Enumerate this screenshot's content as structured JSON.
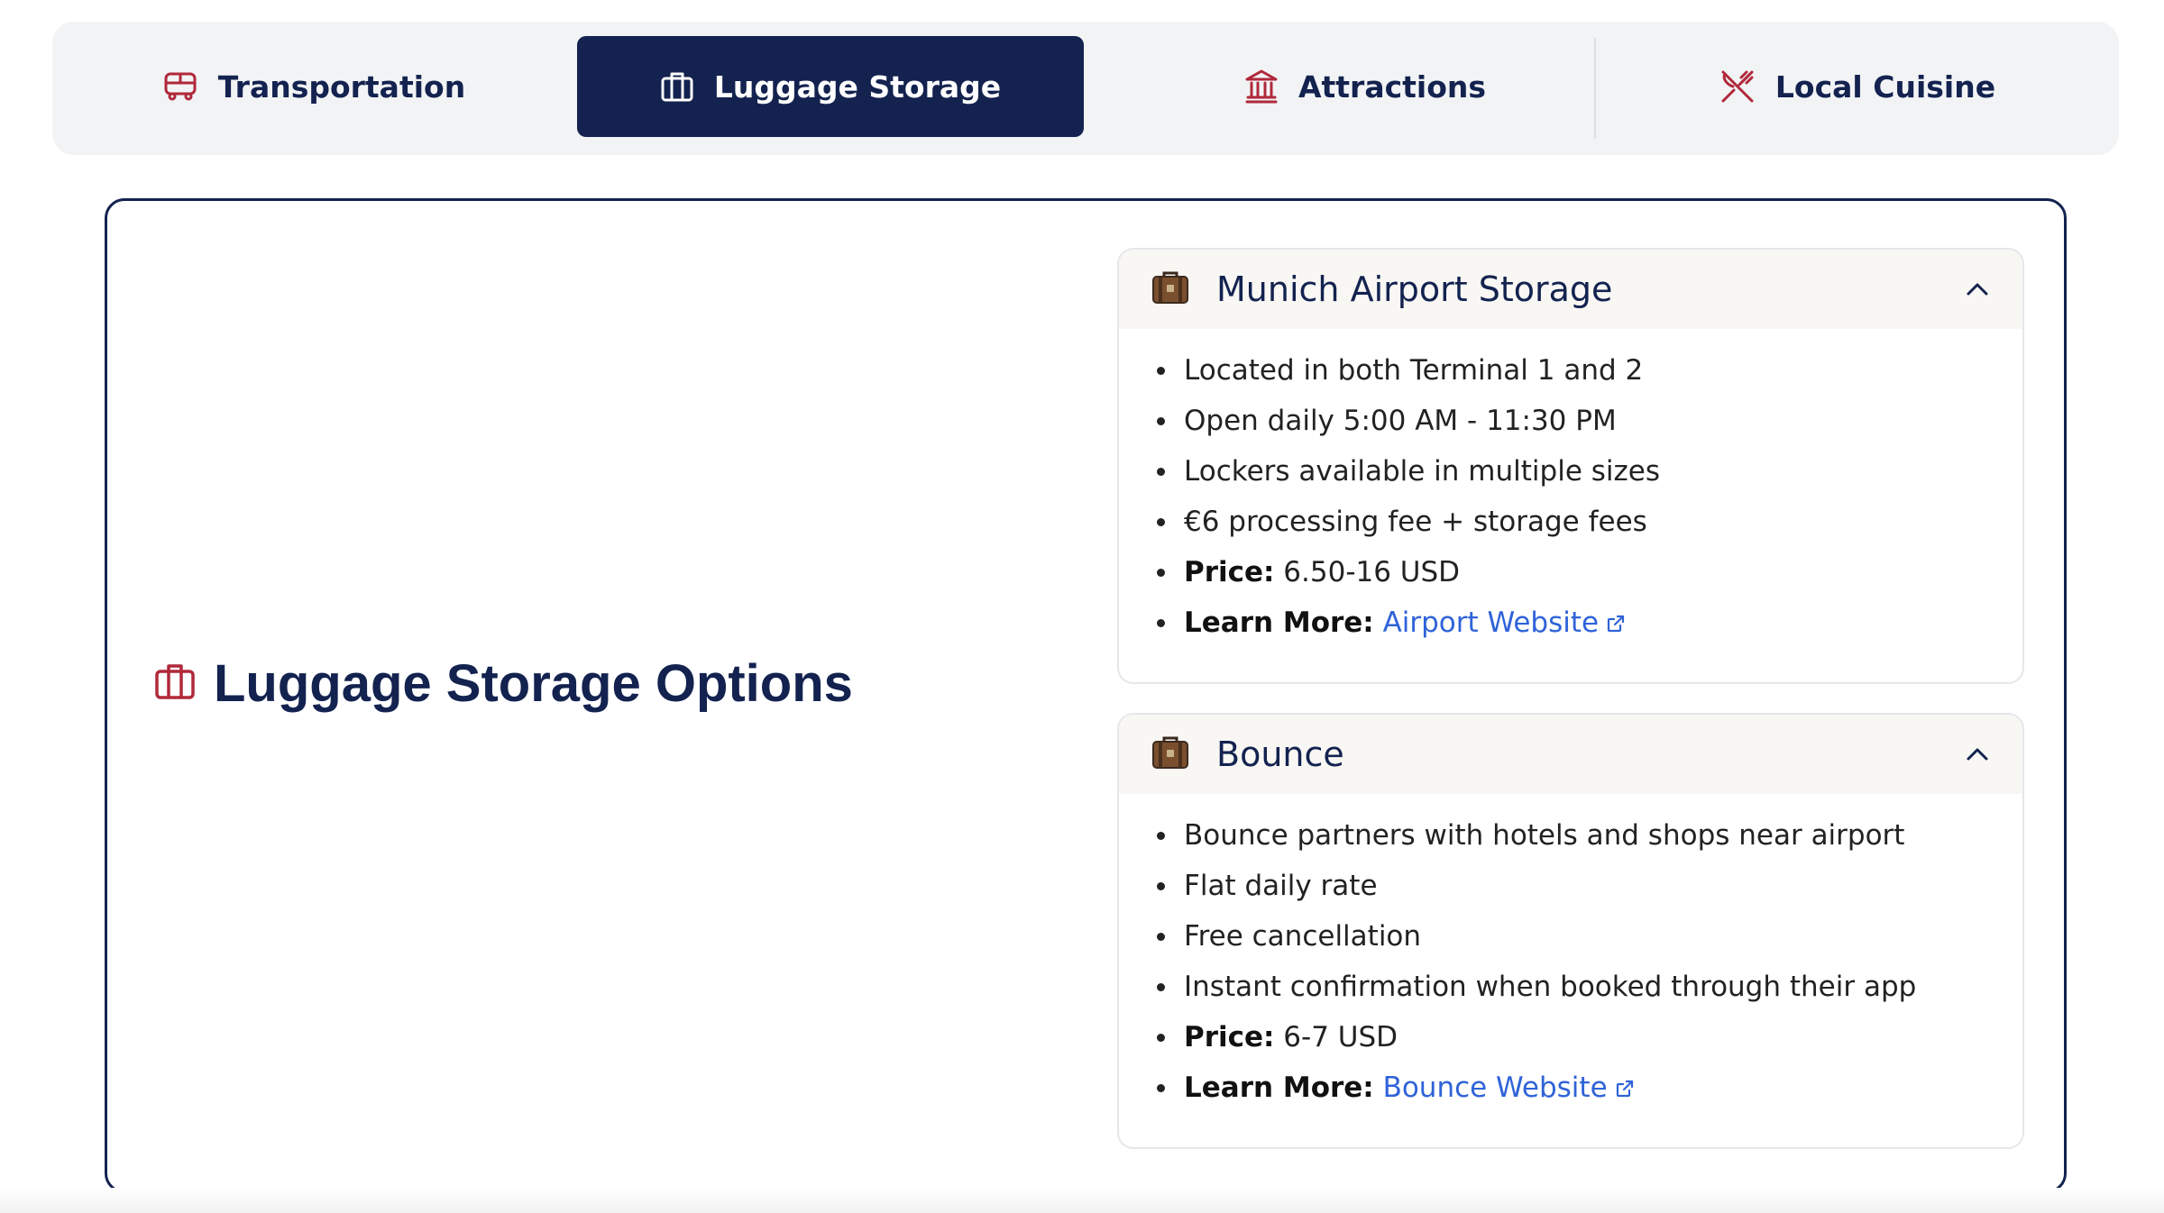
{
  "tabs": [
    {
      "label": "Transportation",
      "icon": "bus-icon",
      "active": false
    },
    {
      "label": "Luggage Storage",
      "icon": "briefcase-icon",
      "active": true
    },
    {
      "label": "Attractions",
      "icon": "landmark-icon",
      "active": false
    },
    {
      "label": "Local Cuisine",
      "icon": "utensils-crossed-icon",
      "active": false
    }
  ],
  "section": {
    "title": "Luggage Storage Options",
    "icon": "briefcase-icon"
  },
  "cards": [
    {
      "title": "Munich Airport Storage",
      "icon": "luggage-emoji",
      "expanded": true,
      "items": [
        "Located in both Terminal 1 and 2",
        "Open daily 5:00 AM - 11:30 PM",
        "Lockers available in multiple sizes",
        "€6 processing fee + storage fees"
      ],
      "price_label": "Price:",
      "price": "6.50-16 USD",
      "learn_label": "Learn More:",
      "link_text": "Airport Website"
    },
    {
      "title": "Bounce",
      "icon": "luggage-emoji",
      "expanded": true,
      "items": [
        "Bounce partners with hotels and shops near airport",
        "Flat daily rate",
        "Free cancellation",
        "Instant confirmation when booked through their app"
      ],
      "price_label": "Price:",
      "price": "6-7 USD",
      "learn_label": "Learn More:",
      "link_text": "Bounce Website"
    }
  ],
  "colors": {
    "navy": "#13224f",
    "accent_red": "#b0283a",
    "link_blue": "#2f63d8",
    "tabbar_bg": "#f2f3f5"
  }
}
